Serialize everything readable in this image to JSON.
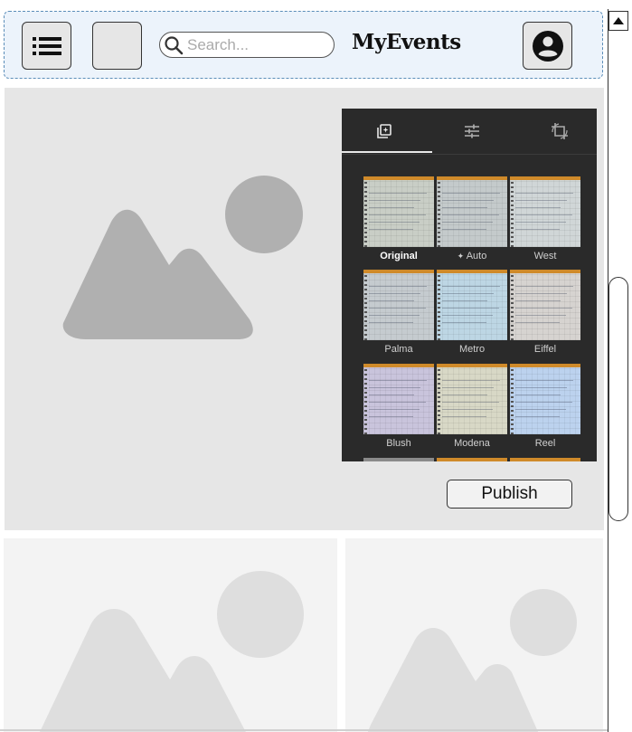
{
  "header": {
    "menu_icon": "list-icon",
    "search": {
      "placeholder": "Search...",
      "icon": "search-icon"
    },
    "brand": "MyEvents",
    "account_icon": "account-circle-icon"
  },
  "hero": {
    "image_icon": "image-placeholder-icon",
    "editor": {
      "tabs": [
        {
          "icon": "filters-icon",
          "active": true
        },
        {
          "icon": "adjust-sliders-icon",
          "active": false
        },
        {
          "icon": "crop-rotate-icon",
          "active": false
        }
      ],
      "filters": [
        {
          "label": "Original",
          "selected": true,
          "tint": "#c9cec6"
        },
        {
          "label": "Auto",
          "icon": "auto-sparkle-icon",
          "tint": "#c4cacb"
        },
        {
          "label": "West",
          "tint": "#d0d6d7"
        },
        {
          "label": "Palma",
          "tint": "#c5cbcf"
        },
        {
          "label": "Metro",
          "tint": "#bdd6e4"
        },
        {
          "label": "Eiffel",
          "tint": "#d6d3d0"
        },
        {
          "label": "Blush",
          "tint": "#c9c4dc"
        },
        {
          "label": "Modena",
          "tint": "#d8d8c6"
        },
        {
          "label": "Reel",
          "tint": "#bcd2ee"
        }
      ]
    },
    "publish_label": "Publish"
  },
  "cards": [
    {
      "image_icon": "image-placeholder-icon"
    },
    {
      "image_icon": "image-placeholder-icon"
    }
  ],
  "colors": {
    "header_bg": "#ecf3fb",
    "header_border": "#5b8db8",
    "placeholder_dark": "#b0b0b0",
    "placeholder_light": "#dedede",
    "editor_bg": "#2a2a2a"
  }
}
